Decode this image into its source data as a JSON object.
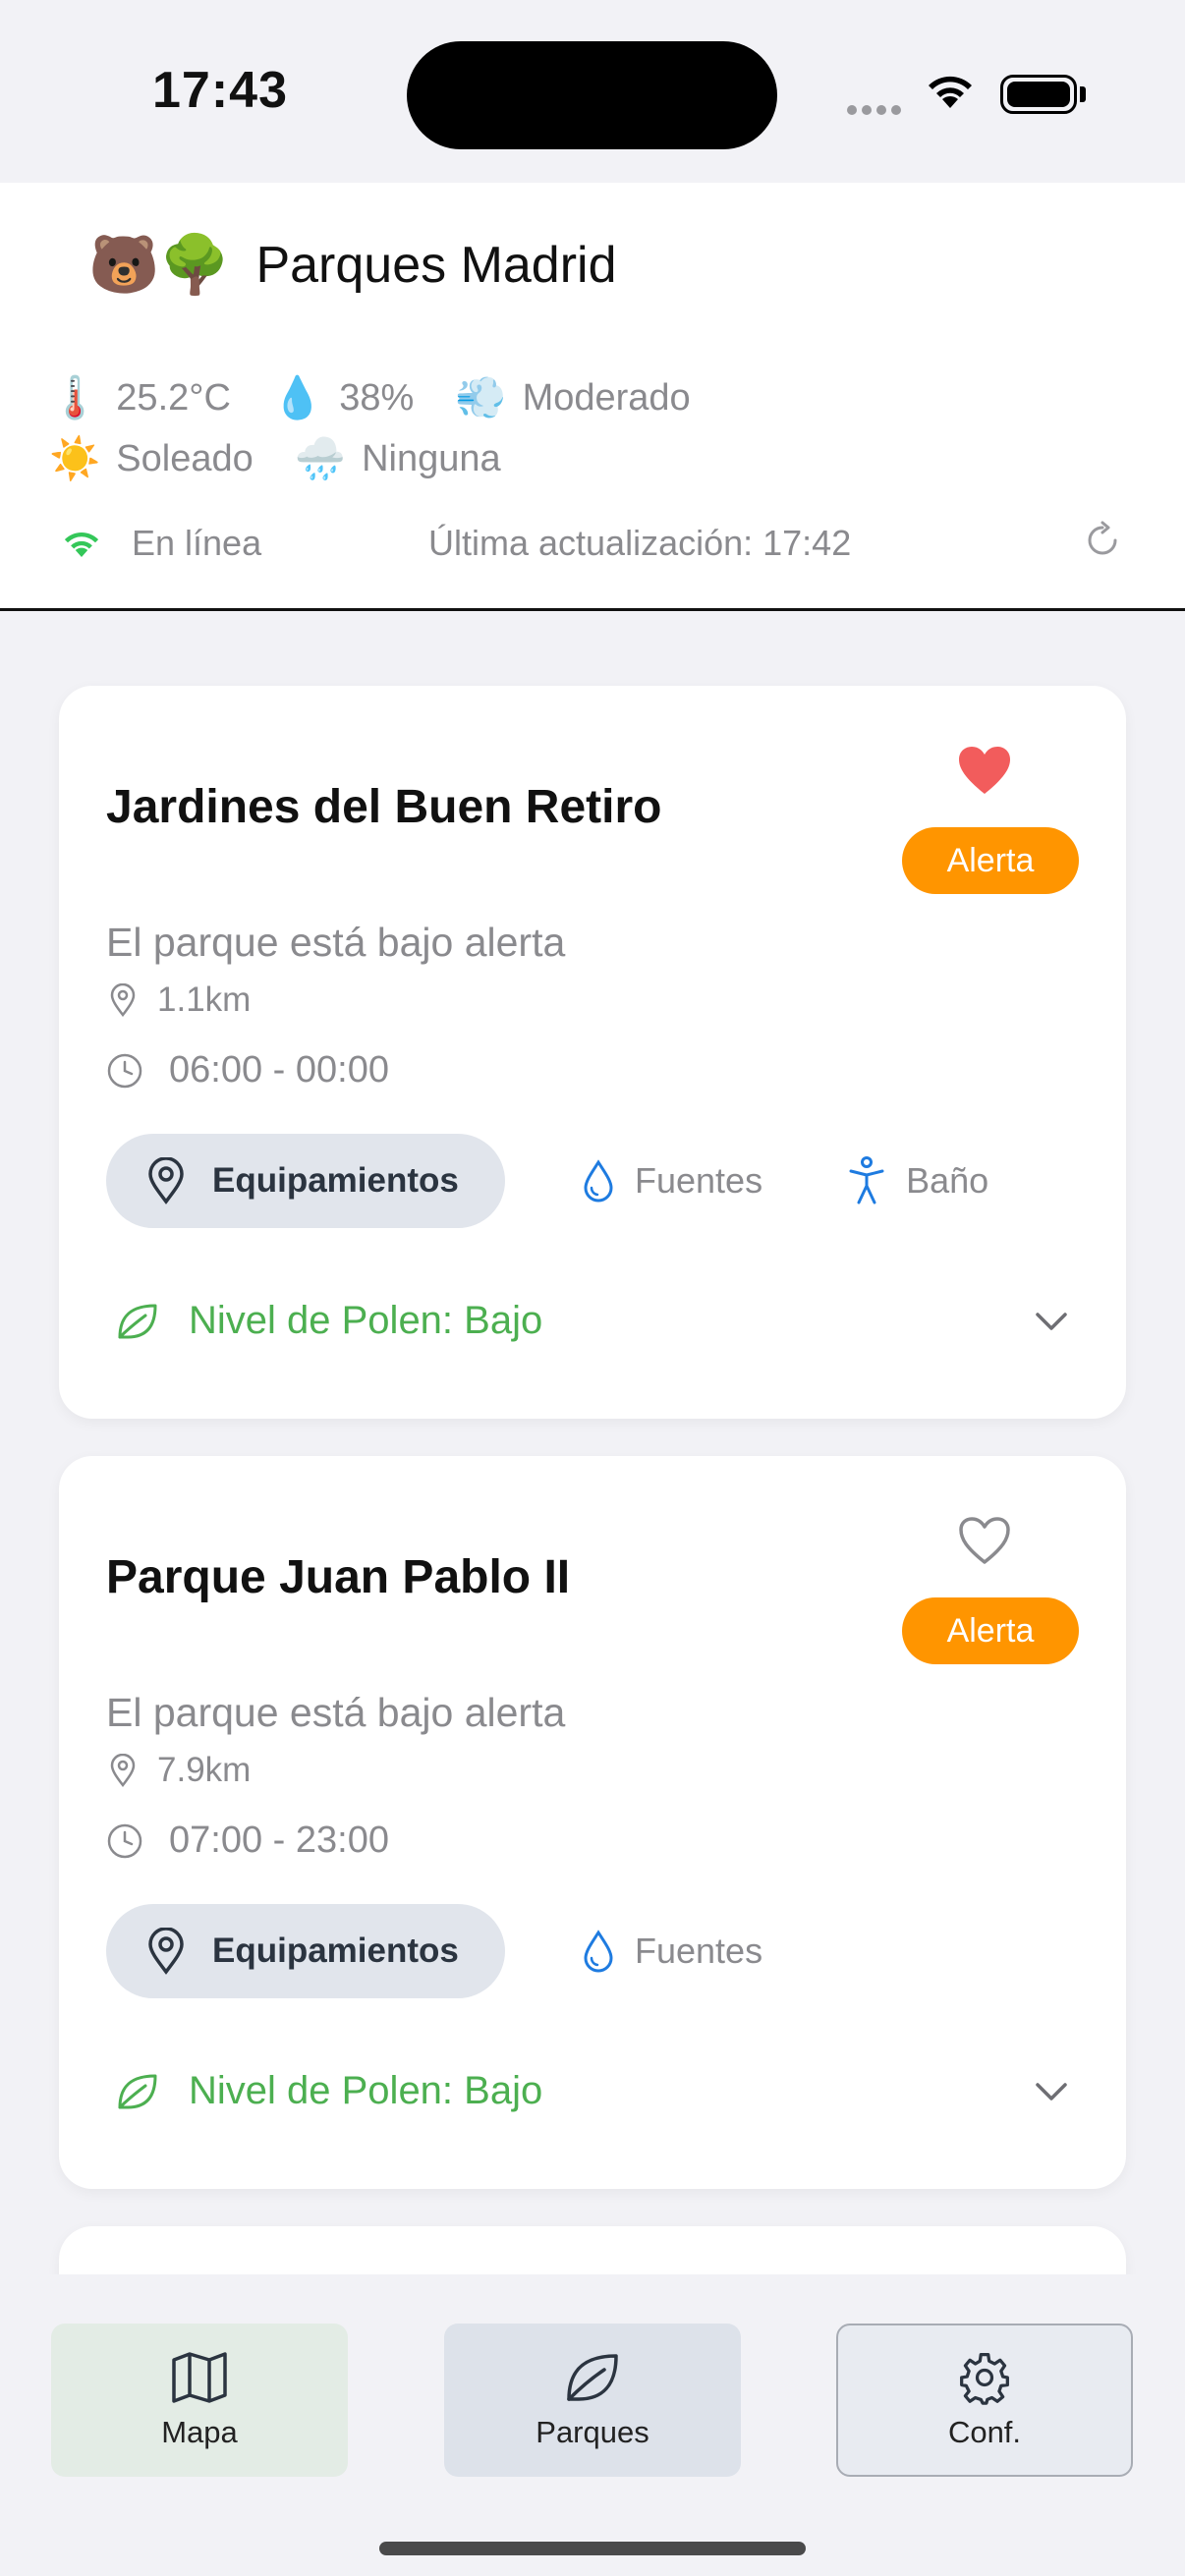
{
  "status_bar": {
    "time": "17:43"
  },
  "header": {
    "emojis": "🐻🌳",
    "title": "Parques Madrid",
    "weather": {
      "temperature_icon": "🌡️",
      "temperature": "25.2°C",
      "humidity_icon": "💧",
      "humidity": "38%",
      "wind_icon": "💨",
      "wind": "Moderado",
      "sky_icon": "☀️",
      "sky": "Soleado",
      "rain_icon": "🌧️",
      "rain": "Ninguna"
    },
    "connection": {
      "status": "En línea",
      "last_update": "Última actualización: 17:42"
    }
  },
  "parks": [
    {
      "name": "Jardines del Buen Retiro",
      "favorite": true,
      "badge": "Alerta",
      "status_text": "El parque está bajo alerta",
      "distance": "1.1km",
      "hours": "06:00 - 00:00",
      "equipment_label": "Equipamientos",
      "amenities": [
        "Fuentes",
        "Baño"
      ],
      "pollen": "Nivel de Polen: Bajo"
    },
    {
      "name": "Parque Juan Pablo II",
      "favorite": false,
      "badge": "Alerta",
      "status_text": "El parque está bajo alerta",
      "distance": "7.9km",
      "hours": "07:00 - 23:00",
      "equipment_label": "Equipamientos",
      "amenities": [
        "Fuentes"
      ],
      "pollen": "Nivel de Polen: Bajo"
    }
  ],
  "tabs": [
    {
      "label": "Mapa",
      "icon": "map-icon"
    },
    {
      "label": "Parques",
      "icon": "leaf-icon"
    },
    {
      "label": "Conf.",
      "icon": "gear-icon"
    }
  ],
  "colors": {
    "alert": "#ff9500",
    "favorite": "#f25c5c",
    "pollen_low": "#4caf50",
    "online": "#34c759",
    "amenity_icon": "#1e7be0"
  }
}
